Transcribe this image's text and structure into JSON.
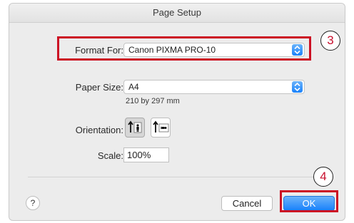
{
  "dialog": {
    "title": "Page Setup"
  },
  "format_for": {
    "label": "Format For:",
    "value": "Canon PIXMA PRO-10",
    "icon": "popup-stepper-icon"
  },
  "paper_size": {
    "label": "Paper Size:",
    "value": "A4",
    "dimensions": "210 by 297 mm",
    "icon": "popup-stepper-icon"
  },
  "orientation": {
    "label": "Orientation:",
    "options": [
      {
        "name": "portrait",
        "selected": true,
        "icon": "portrait-orientation-icon"
      },
      {
        "name": "landscape",
        "selected": false,
        "icon": "landscape-orientation-icon"
      }
    ]
  },
  "scale": {
    "label": "Scale:",
    "value": "100%"
  },
  "footer": {
    "help_label": "?",
    "cancel_label": "Cancel",
    "ok_label": "OK"
  },
  "annotations": {
    "callout_format": "3",
    "callout_ok": "4",
    "highlight_color": "#cc1124"
  },
  "colors": {
    "accent": "#1a82fb",
    "dialog_bg": "#ececec"
  }
}
